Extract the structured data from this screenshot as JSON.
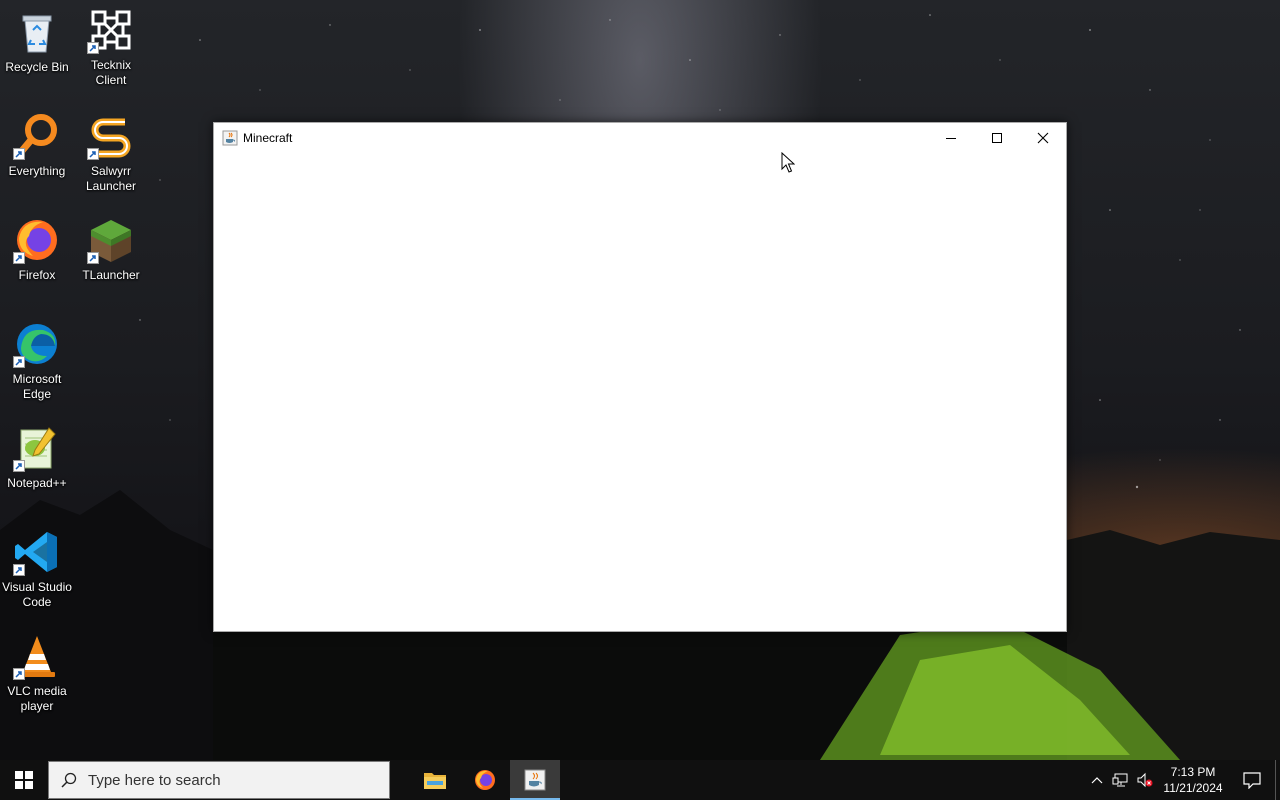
{
  "desktop": {
    "icons": [
      {
        "label": "Recycle Bin",
        "icon": "recycle-bin-icon"
      },
      {
        "label": "Tecknix Client",
        "icon": "tecknix-client-icon"
      },
      {
        "label": "Everything",
        "icon": "everything-search-icon"
      },
      {
        "label": "Salwyrr Launcher",
        "icon": "salwyrr-launcher-icon"
      },
      {
        "label": "Firefox",
        "icon": "firefox-icon"
      },
      {
        "label": "TLauncher",
        "icon": "tlauncher-grass-block-icon"
      },
      {
        "label": "Microsoft Edge",
        "icon": "edge-icon"
      },
      {
        "label": "Notepad++",
        "icon": "notepad-plus-plus-icon"
      },
      {
        "label": "Visual Studio Code",
        "icon": "vscode-icon"
      },
      {
        "label": "VLC media player",
        "icon": "vlc-icon"
      }
    ]
  },
  "window": {
    "title": "Minecraft",
    "icon": "java-coffee-cup-icon",
    "buttons": [
      "minimize",
      "maximize",
      "close"
    ]
  },
  "taskbar": {
    "search_placeholder": "Type here to search",
    "pinned": [
      "file-explorer-icon",
      "firefox-icon",
      "java-minecraft-icon"
    ],
    "clock_time": "7:13 PM",
    "clock_date": "11/21/2024"
  },
  "colors": {
    "taskbar_bg": "#101010",
    "active_indicator": "#76b9ed"
  }
}
